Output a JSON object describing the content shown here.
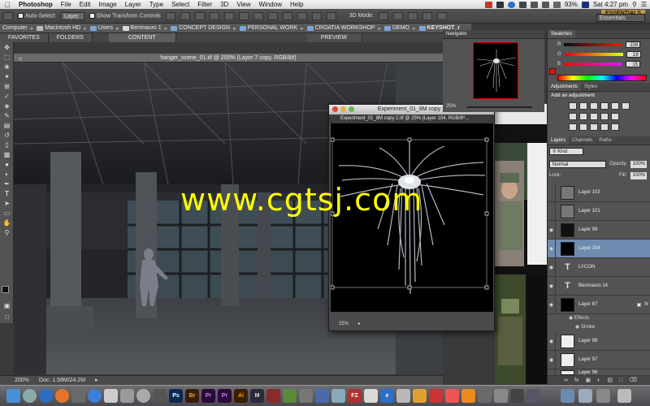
{
  "menubar": {
    "app_name": "Photoshop",
    "items": [
      "File",
      "Edit",
      "Image",
      "Layer",
      "Type",
      "Select",
      "Filter",
      "3D",
      "View",
      "Window",
      "Help"
    ],
    "battery": "93%",
    "clock": "Sat 4:27 pm"
  },
  "options_bar": {
    "auto_select_label": "Auto-Select:",
    "auto_select_value": "Layer",
    "transform_label": "Show Transform Controls",
    "mode_label": "3D Mode:",
    "workspace_badge": "ESSENTIALS",
    "workspace_select": "Essentials"
  },
  "breadcrumbs": [
    "Computer",
    "Macintosh HD",
    "Users",
    "Benmauro 1",
    "CONCEPT DESIGN",
    "PERSONAL WORK",
    "CROATIA WORKSHOP",
    "DEMO",
    "KEYSHOT_r"
  ],
  "bridge_tabs": [
    "FAVORITES",
    "FOLDERS",
    "CONTENT",
    "PREVIEW"
  ],
  "main_document": {
    "title": "hanger_scene_01.tif @ 200% (Layer 7 copy, RGB/8#)",
    "zoom": "200%",
    "doc_size": "Doc: 1.58M/24.2M"
  },
  "floating_document": {
    "window_title": "Experiment_01_8M copy 2",
    "tab_title": "Experiment_01_8M copy 2.tif @ 25% (Layer 104, RGB/8*...",
    "zoom": "25%"
  },
  "navigator": {
    "tab": "Navigator",
    "zoom": "25%"
  },
  "swatches_panel": {
    "tab": "Swatches",
    "r": "228",
    "g": "19",
    "b": "15"
  },
  "adjustments_panel": {
    "tabs": [
      "Adjustments",
      "Styles"
    ],
    "heading": "Add an adjustment"
  },
  "layers_panel": {
    "tabs": [
      "Layers",
      "Channels",
      "Paths"
    ],
    "filter_kind": "Kind",
    "blend_mode": "Normal",
    "opacity_label": "Opacity:",
    "opacity_value": "100%",
    "lock_label": "Lock:",
    "fill_label": "Fill:",
    "fill_value": "100%",
    "layers": [
      {
        "name": "Layer 102"
      },
      {
        "name": "Layer 101"
      },
      {
        "name": "Layer 99"
      },
      {
        "name": "Layer 104"
      },
      {
        "name": "LYCON"
      },
      {
        "name": "Benmauro 14"
      },
      {
        "name": "Layer 87"
      },
      {
        "name": "Layer 98"
      },
      {
        "name": "Layer 97"
      },
      {
        "name": "Layer 96"
      }
    ],
    "effects_label": "Effects",
    "stroke_label": "Stroke"
  },
  "dock": {
    "labels": [
      "Ps",
      "Br",
      "Pr",
      "Pr",
      "Ai",
      "M",
      "FZ",
      "e"
    ]
  },
  "watermark": "www.cgtsj.com"
}
